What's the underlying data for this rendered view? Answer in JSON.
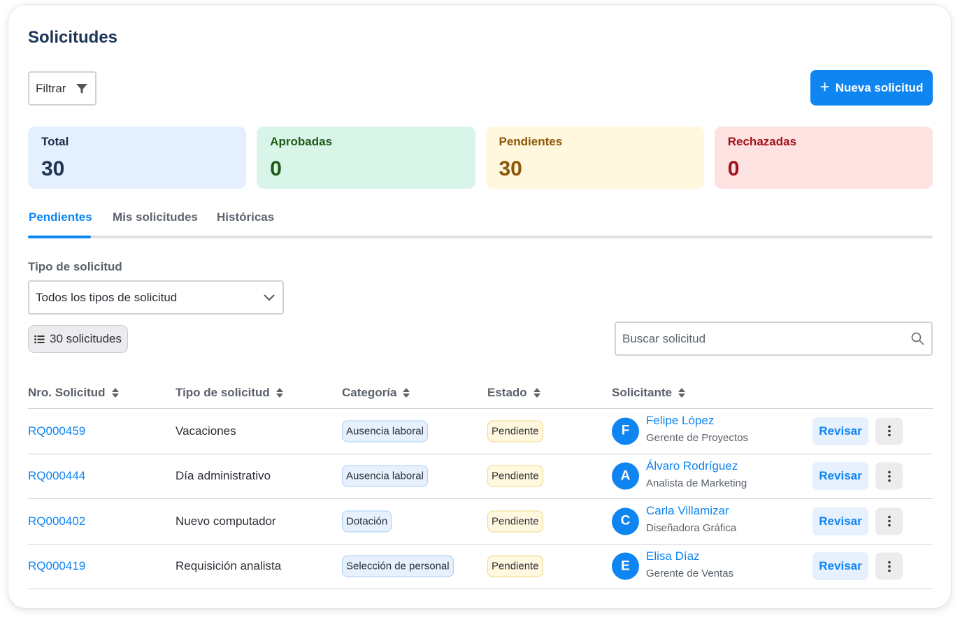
{
  "page": {
    "title": "Solicitudes"
  },
  "toolbar": {
    "filter_label": "Filtrar",
    "new_label": "Nueva solicitud"
  },
  "stats": [
    {
      "label": "Total",
      "value": "30"
    },
    {
      "label": "Aprobadas",
      "value": "0"
    },
    {
      "label": "Pendientes",
      "value": "30"
    },
    {
      "label": "Rechazadas",
      "value": "0"
    }
  ],
  "tabs": [
    {
      "label": "Pendientes",
      "active": true
    },
    {
      "label": "Mis solicitudes",
      "active": false
    },
    {
      "label": "Históricas",
      "active": false
    }
  ],
  "filters": {
    "type_label": "Tipo de solicitud",
    "type_value": "Todos los tipos de solicitud",
    "count_label": "30 solicitudes",
    "search_placeholder": "Buscar solicitud"
  },
  "table": {
    "columns": [
      "Nro. Solicitud",
      "Tipo de solicitud",
      "Categoría",
      "Estado",
      "Solicitante"
    ],
    "rows": [
      {
        "id": "RQ000459",
        "type": "Vacaciones",
        "category": "Ausencia laboral",
        "state": "Pendiente",
        "initial": "F",
        "name": "Felipe López",
        "role": "Gerente de Proyectos",
        "action": "Revisar"
      },
      {
        "id": "RQ000444",
        "type": "Día administrativo",
        "category": "Ausencia laboral",
        "state": "Pendiente",
        "initial": "A",
        "name": "Álvaro Rodríguez",
        "role": "Analista de Marketing",
        "action": "Revisar"
      },
      {
        "id": "RQ000402",
        "type": "Nuevo computador",
        "category": "Dotación",
        "state": "Pendiente",
        "initial": "C",
        "name": "Carla Villamizar",
        "role": "Diseñadora Gráfica",
        "action": "Revisar"
      },
      {
        "id": "RQ000419",
        "type": "Requisición analista",
        "category": "Selección de personal",
        "state": "Pendiente",
        "initial": "E",
        "name": "Elisa Díaz",
        "role": "Gerente de Ventas",
        "action": "Revisar"
      }
    ]
  },
  "colors": {
    "accent": "#0f85f2",
    "total_bg": "#e4f0fd",
    "approved_bg": "#d9f4e8",
    "pending_bg": "#fff7de",
    "rejected_bg": "#fde2e2"
  },
  "icons": [
    "filter-icon",
    "plus-icon",
    "chevron-down-icon",
    "list-icon",
    "search-icon",
    "sort-icon",
    "more-vertical-icon"
  ]
}
